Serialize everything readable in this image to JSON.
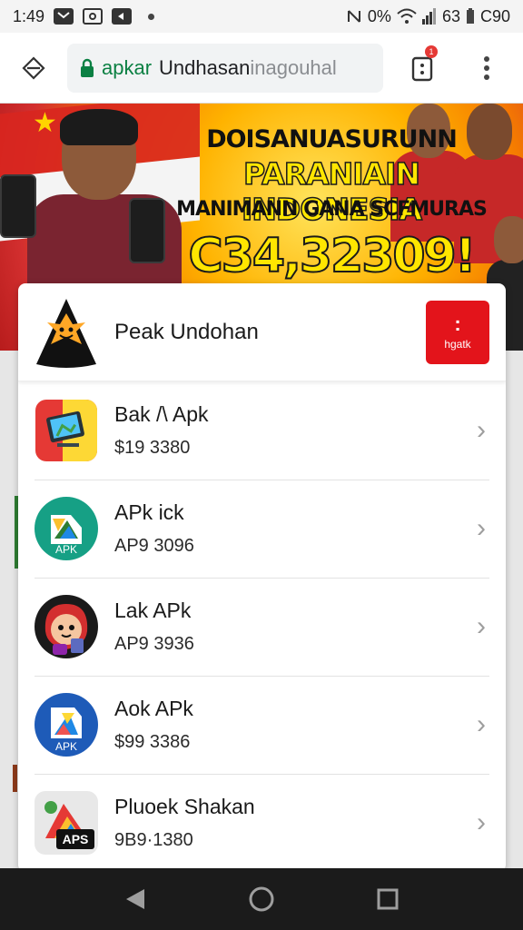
{
  "status_bar": {
    "time": "1:49",
    "right_text": "0%",
    "signal_text": "63",
    "battery_text": "C90"
  },
  "browser": {
    "url_secure_part": "apkar",
    "url_main_part": "Undhasan",
    "url_faded_part": "inagouhal",
    "tab_badge": "1"
  },
  "hero": {
    "line1": "DOISANUASURUNN",
    "line2": "PARANIAIN INDONESIA",
    "line3": "MANIMANN GANA SCFMURAS",
    "line4": "C34,32309!"
  },
  "card": {
    "header_title": "Peak Undohan",
    "badge_icon": ":",
    "badge_text": "hgatk",
    "items": [
      {
        "name": "Bak /\\ Apk",
        "price": "$19 3380",
        "icon": "monitor-app-icon"
      },
      {
        "name": "APk ick",
        "price": "AP9 3096",
        "icon": "green-apk-icon",
        "icon_label": "APK"
      },
      {
        "name": "Lak APk",
        "price": "AP9 3936",
        "icon": "character-app-icon"
      },
      {
        "name": "Aok APk",
        "price": "$99 3386",
        "icon": "blue-apk-icon",
        "icon_label": "APK"
      },
      {
        "name": "Pluoek Shakan",
        "price": "9B9·1380",
        "icon": "aps-app-icon",
        "icon_label": "APS"
      }
    ]
  },
  "colors": {
    "brand_red": "#e3141b",
    "secure_green": "#0b8043",
    "hero_yellow": "#ffe600"
  }
}
